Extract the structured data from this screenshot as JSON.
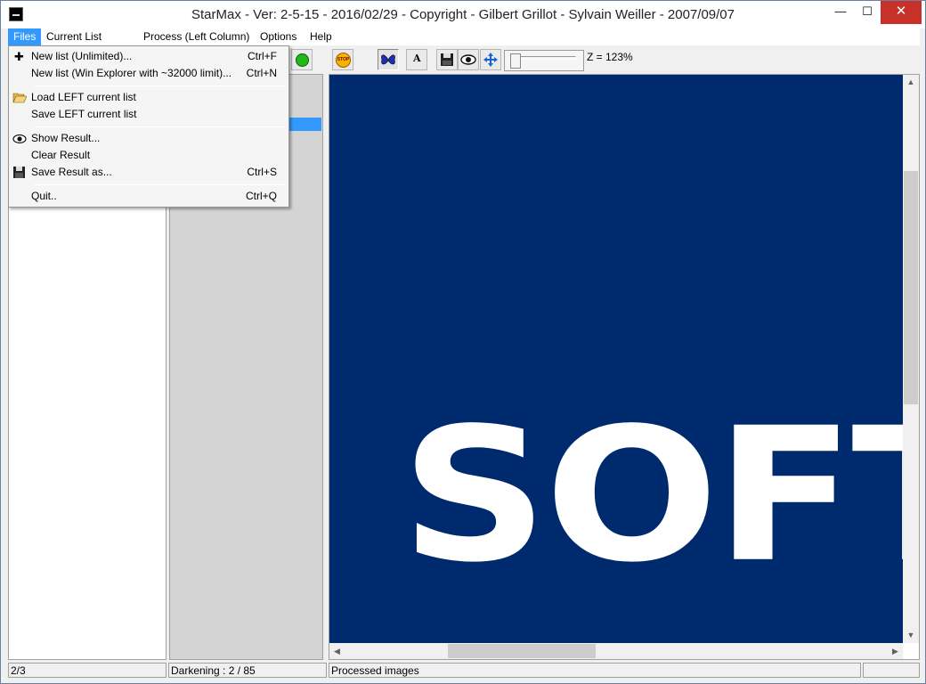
{
  "window": {
    "title": "StarMax - Ver: 2-5-15 - 2016/02/29 - Copyright - Gilbert Grillot - Sylvain Weiller - 2007/09/07",
    "min_glyph": "—",
    "max_glyph": "☐",
    "close_glyph": "✕"
  },
  "menubar": {
    "items": [
      "Files",
      "Current List",
      "Process (Left Column)",
      "Options",
      "Help"
    ]
  },
  "files_menu": {
    "items": [
      {
        "label": "New list (Unlimited)...",
        "shortcut": "Ctrl+F",
        "icon": "plus-icon"
      },
      {
        "label": "New list (Win Explorer with ~32000 limit)...",
        "shortcut": "Ctrl+N"
      },
      {
        "label": "Load LEFT current list",
        "icon": "folder-open-icon"
      },
      {
        "label": "Save LEFT current list"
      },
      {
        "label": "Show Result...",
        "icon": "eye-icon"
      },
      {
        "label": "Clear Result"
      },
      {
        "label": "Save Result as...",
        "shortcut": "Ctrl+S",
        "icon": "floppy-icon"
      },
      {
        "label": "Quit..",
        "shortcut": "Ctrl+Q"
      }
    ]
  },
  "toolbar": {
    "stop_label": "STOP",
    "font_button": "A",
    "zoom": "Z = 123%"
  },
  "viewer": {
    "image_text": "SOFT"
  },
  "statusbar": {
    "count": "2/3",
    "darkening": "Darkening : 2 / 85",
    "status": "Processed images"
  },
  "colors": {
    "accent": "#3399ff",
    "image_bg": "#002a6e"
  }
}
